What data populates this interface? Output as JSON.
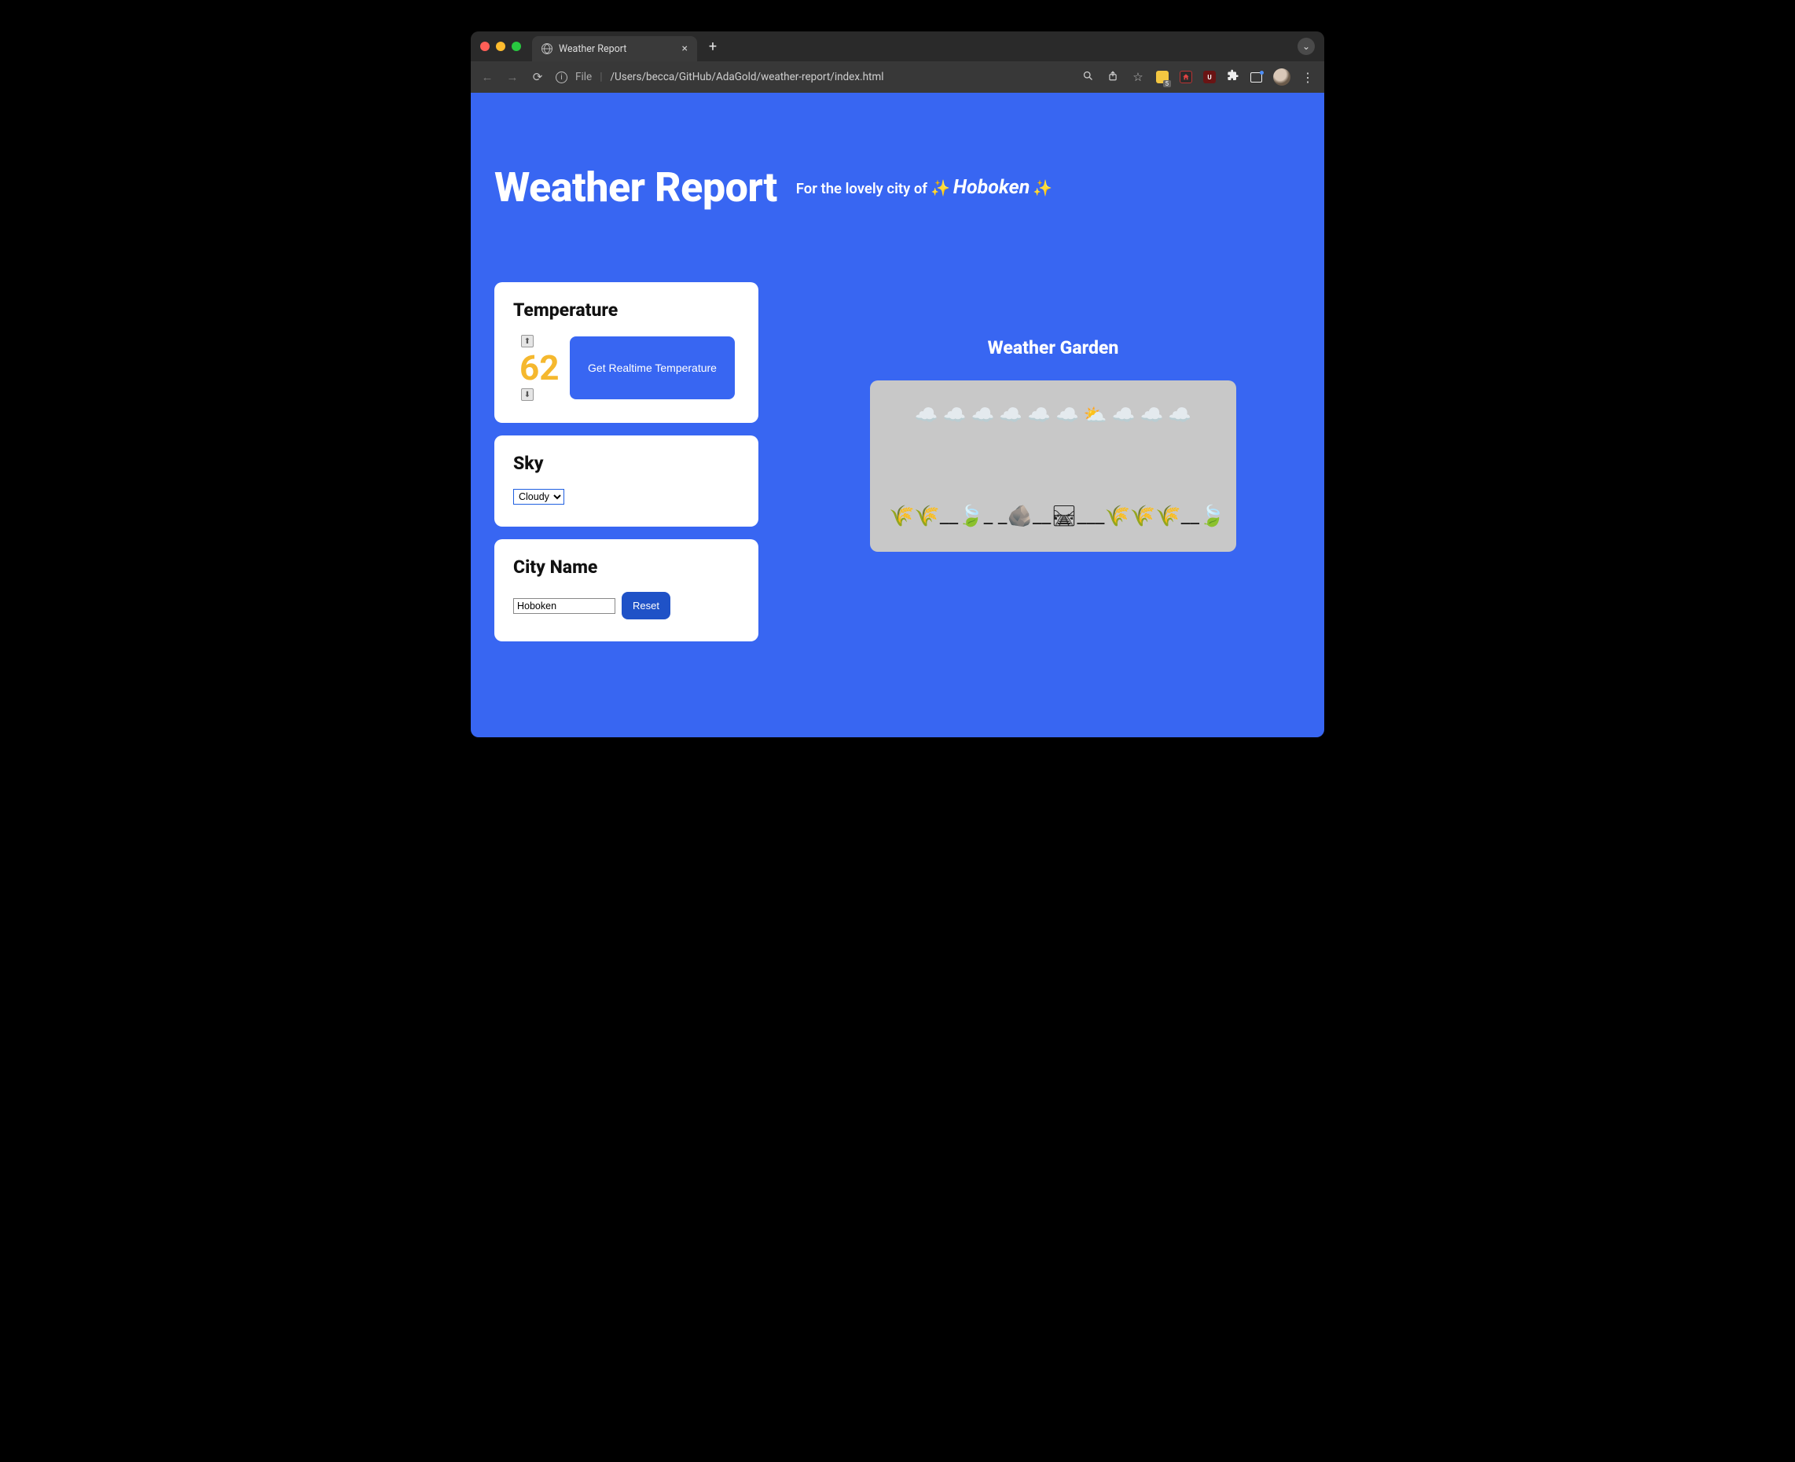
{
  "browser": {
    "tab_title": "Weather Report",
    "url_scheme": "File",
    "url_path": "/Users/becca/GitHub/AdaGold/weather-report/index.html",
    "extension_badge": "5"
  },
  "header": {
    "title": "Weather Report",
    "tagline_prefix": "For the lovely city of",
    "sparkle": "✨",
    "city_display": "Hoboken"
  },
  "temperature_card": {
    "heading": "Temperature",
    "value": "62",
    "realtime_button": "Get Realtime Temperature",
    "arrow_up": "⬆",
    "arrow_down": "⬇"
  },
  "sky_card": {
    "heading": "Sky",
    "selected": "Cloudy"
  },
  "city_card": {
    "heading": "City Name",
    "input_value": "Hoboken",
    "reset_label": "Reset"
  },
  "garden": {
    "heading": "Weather Garden",
    "sky_row": "☁️ ☁️   ☁️ ☁️  ☁️ ☁️   ⛅  ☁️   ☁️ ☁️",
    "ground_row": "🌾🌾__🍃_ _🪨__🛤___🌾🌾🌾__🍃"
  }
}
